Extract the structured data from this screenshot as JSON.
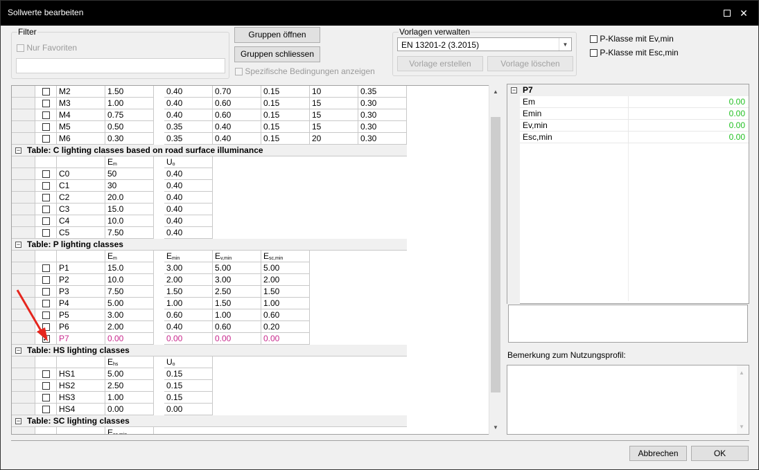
{
  "window": {
    "title": "Sollwerte bearbeiten",
    "maximize_label": "",
    "close_label": "✕"
  },
  "filter": {
    "legend": "Filter",
    "favorites_label": "Nur Favoriten",
    "search_value": ""
  },
  "groups": {
    "open_label": "Gruppen öffnen",
    "close_label": "Gruppen schliessen",
    "specific_label": "Spezifische Bedingungen anzeigen"
  },
  "templates": {
    "legend": "Vorlagen verwalten",
    "selected": "EN 13201-2 (3.2015)",
    "create_label": "Vorlage erstellen",
    "delete_label": "Vorlage löschen"
  },
  "options": {
    "p_class_ev_label": "P-Klasse mit Ev,min",
    "p_class_esc_label": "P-Klasse mit Esc,min"
  },
  "tables": {
    "m_rows": [
      [
        "M2",
        "1.50",
        "0.40",
        "0.70",
        "0.15",
        "10",
        "0.35"
      ],
      [
        "M3",
        "1.00",
        "0.40",
        "0.60",
        "0.15",
        "15",
        "0.30"
      ],
      [
        "M4",
        "0.75",
        "0.40",
        "0.60",
        "0.15",
        "15",
        "0.30"
      ],
      [
        "M5",
        "0.50",
        "0.35",
        "0.40",
        "0.15",
        "15",
        "0.30"
      ],
      [
        "M6",
        "0.30",
        "0.35",
        "0.40",
        "0.15",
        "20",
        "0.30"
      ]
    ],
    "c": {
      "title": "Table: C lighting classes based on road surface illuminance",
      "h1": "E",
      "h1sub": "m",
      "h2": "U",
      "h2sub": "o",
      "rows": [
        [
          "C0",
          "50",
          "0.40"
        ],
        [
          "C1",
          "30",
          "0.40"
        ],
        [
          "C2",
          "20.0",
          "0.40"
        ],
        [
          "C3",
          "15.0",
          "0.40"
        ],
        [
          "C4",
          "10.0",
          "0.40"
        ],
        [
          "C5",
          "7.50",
          "0.40"
        ]
      ]
    },
    "p": {
      "title": "Table: P lighting classes",
      "h1": "E",
      "h1sub": "m",
      "h2": "E",
      "h2sub": "min",
      "h3": "E",
      "h3sub": "v,min",
      "h4": "E",
      "h4sub": "sc,min",
      "rows": [
        [
          "P1",
          "15.0",
          "3.00",
          "5.00",
          "5.00"
        ],
        [
          "P2",
          "10.0",
          "2.00",
          "3.00",
          "2.00"
        ],
        [
          "P3",
          "7.50",
          "1.50",
          "2.50",
          "1.50"
        ],
        [
          "P4",
          "5.00",
          "1.00",
          "1.50",
          "1.00"
        ],
        [
          "P5",
          "3.00",
          "0.60",
          "1.00",
          "0.60"
        ],
        [
          "P6",
          "2.00",
          "0.40",
          "0.60",
          "0.20"
        ],
        [
          "P7",
          "0.00",
          "0.00",
          "0.00",
          "0.00"
        ]
      ]
    },
    "hs": {
      "title": "Table: HS lighting classes",
      "h1": "E",
      "h1sub": "hs",
      "h2": "U",
      "h2sub": "o",
      "rows": [
        [
          "HS1",
          "5.00",
          "0.15"
        ],
        [
          "HS2",
          "2.50",
          "0.15"
        ],
        [
          "HS3",
          "1.00",
          "0.15"
        ],
        [
          "HS4",
          "0.00",
          "0.00"
        ]
      ]
    },
    "sc": {
      "title": "Table: SC lighting classes",
      "h1": "E",
      "h1sub": "sc,min"
    }
  },
  "props": {
    "title": "P7",
    "items": [
      {
        "name": "Em",
        "value": "0.00"
      },
      {
        "name": "Emin",
        "value": "0.00"
      },
      {
        "name": "Ev,min",
        "value": "0.00"
      },
      {
        "name": "Esc,min",
        "value": "0.00"
      }
    ]
  },
  "note": {
    "label": "Bemerkung zum Nutzungsprofil:"
  },
  "footer": {
    "cancel_label": "Abbrechen",
    "ok_label": "OK"
  },
  "colors": {
    "accent_pink": "#c8288c",
    "value_green": "#22c022",
    "arrow_red": "#e5261e"
  }
}
